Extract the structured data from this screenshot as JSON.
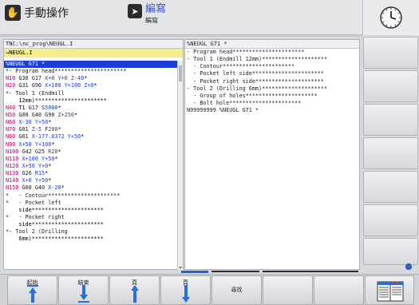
{
  "header": {
    "mode_main": "手動操作",
    "mode_sub_title": "編寫",
    "mode_sub_caption": "編寫",
    "clock_icon": "analog-clock-icon"
  },
  "left_pane": {
    "path": "TNC:\\nc_prog\\NEUGL.I",
    "file": "→NEUGL.I",
    "lines": [
      {
        "text": "%NEUGL G71 *",
        "selected": true
      },
      {
        "text": "*- Program head**********************"
      },
      {
        "text": "N10 G30 G17 X+0 Y+0 Z-40*"
      },
      {
        "text": "N20 G31 G90 X+100 Y+100 Z+0*"
      },
      {
        "text": "*- Tool 1 (Endmill"
      },
      {
        "text": "    12mm)**********************"
      },
      {
        "text": "N40 T1 G17 S5000*"
      },
      {
        "text": "N50 G00 G40 G90 Z+250*"
      },
      {
        "text": "N60 X-30 Y+50*"
      },
      {
        "text": "N70 G01 Z-5 F200*"
      },
      {
        "text": "N80 G01 X-177.8372 Y+50*"
      },
      {
        "text": "N90 X+50 Y+100*"
      },
      {
        "text": "N100 G42 G25 R20*"
      },
      {
        "text": "N110 X+100 Y+50*"
      },
      {
        "text": "N120 X+50 Y+0*"
      },
      {
        "text": "N130 G26 R15*"
      },
      {
        "text": "N140 X+0 Y+50*"
      },
      {
        "text": "N150 G00 G40 X-20*"
      },
      {
        "text": "*   - Contour**********************"
      },
      {
        "text": "*   - Pocket left"
      },
      {
        "text": "    side**********************"
      },
      {
        "text": "*   - Pocket right"
      },
      {
        "text": "    side**********************"
      },
      {
        "text": "*- Tool 2 (Drilling"
      },
      {
        "text": "    6mm)**********************"
      }
    ]
  },
  "right_pane": {
    "title": "%NEUGL G71 *",
    "lines": [
      "- Program head**********************",
      "- Tool 1 (Endmill 12mm)********************",
      "  - Contour**********************",
      "  - Pocket left side**********************",
      "  - Pocket right side*********************",
      "- Tool 2 (Drilling 6mm)********************",
      "  - Group of holes**********************",
      "  - Bolt hole**********************",
      "N99999999 %NEUGL G71 *"
    ]
  },
  "softkeys": [
    {
      "label": "起始",
      "icon": "arrow-up-to-top-icon"
    },
    {
      "label": "結束",
      "icon": "arrow-down-to-bottom-icon"
    },
    {
      "label": "頁",
      "icon": "page-up-arrow-icon"
    },
    {
      "label": "頁",
      "icon": "page-down-arrow-icon"
    },
    {
      "label": "尋找",
      "icon": ""
    },
    {
      "label": "",
      "icon": ""
    },
    {
      "label": "",
      "icon": ""
    },
    {
      "label": "",
      "icon": "program-view-icon"
    }
  ],
  "colors": {
    "selection": "#1b3fd6",
    "file_highlight": "#f3ee8a",
    "accent_blue": "#1e64d8"
  }
}
